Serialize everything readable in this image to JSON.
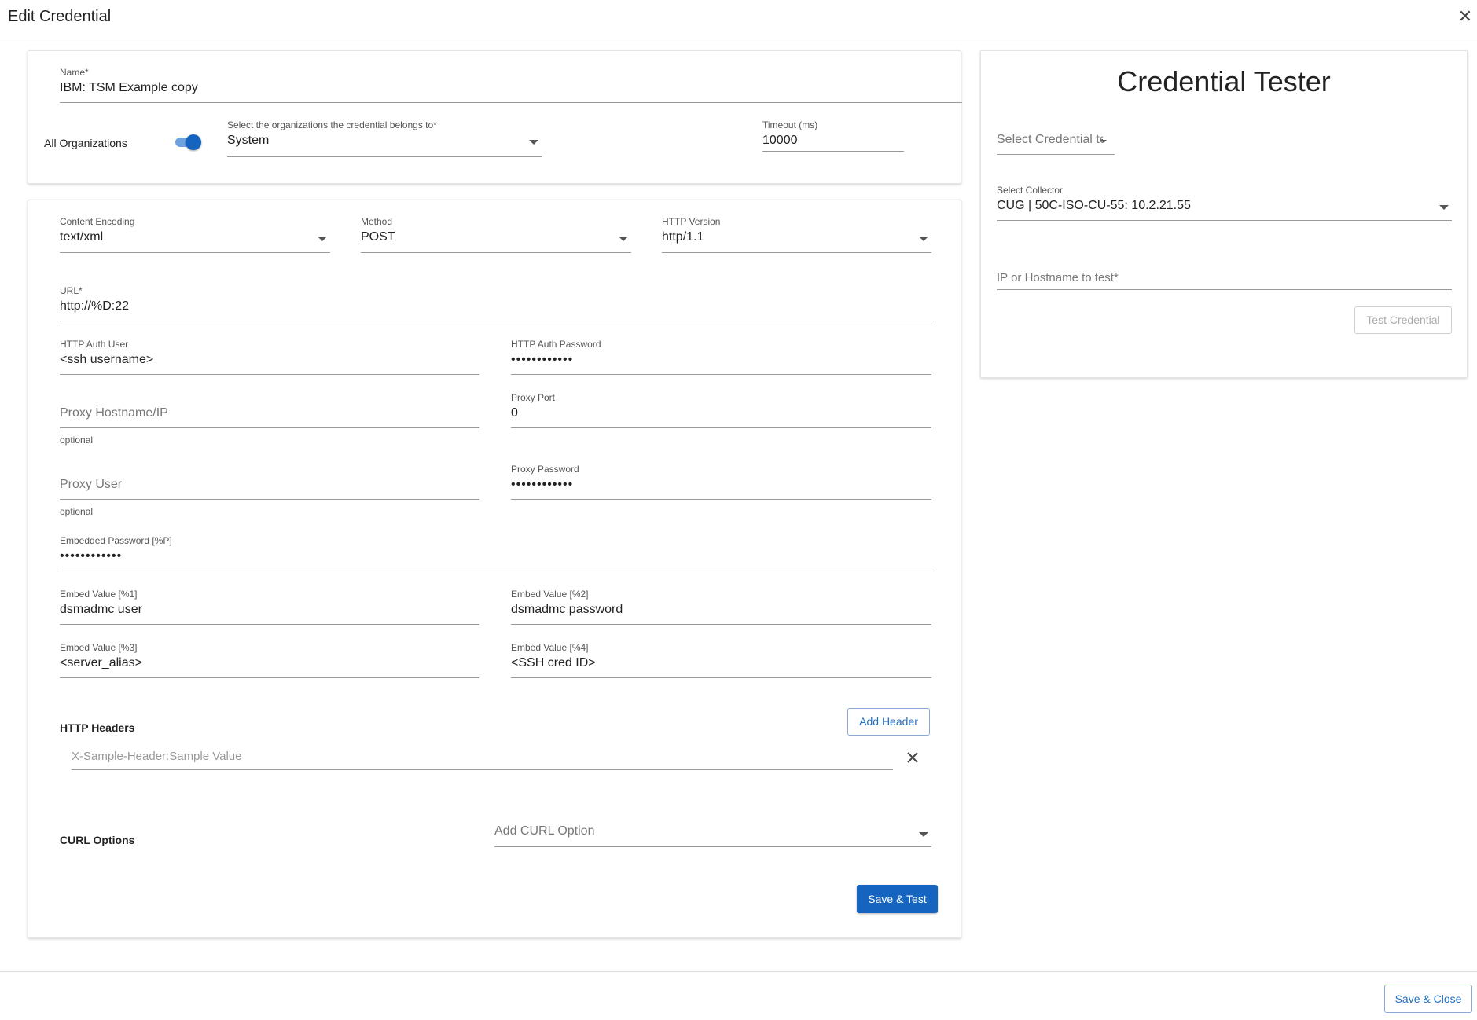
{
  "header": {
    "title": "Edit Credential",
    "close_glyph": "✕"
  },
  "top_card": {
    "name_label": "Name",
    "name_value": "IBM: TSM Example copy",
    "all_orgs_label": "All Organizations",
    "all_orgs_enabled": true,
    "orgs_label": "Select the organizations the credential belongs to",
    "orgs_value": "System",
    "timeout_label": "Timeout (ms)",
    "timeout_value": "10000",
    "required_mark": "*"
  },
  "main_card": {
    "content_encoding_label": "Content Encoding",
    "content_encoding_value": "text/xml",
    "method_label": "Method",
    "method_value": "POST",
    "http_version_label": "HTTP Version",
    "http_version_value": "http/1.1",
    "url_label": "URL",
    "url_value": "http://%D:22",
    "auth_user_label": "HTTP Auth User",
    "auth_user_value": "<ssh username>",
    "auth_password_label": "HTTP Auth Password",
    "auth_password_value": "••••••••••••",
    "proxy_host_placeholder": "Proxy Hostname/IP",
    "proxy_host_helper": "optional",
    "proxy_port_label": "Proxy Port",
    "proxy_port_value": "0",
    "proxy_user_placeholder": "Proxy User",
    "proxy_user_helper": "optional",
    "proxy_password_label": "Proxy Password",
    "proxy_password_value": "••••••••••••",
    "embedded_password_label": "Embedded Password [%P]",
    "embedded_password_value": "••••••••••••",
    "embed1_label": "Embed Value [%1]",
    "embed1_value": "dsmadmc user",
    "embed2_label": "Embed Value [%2]",
    "embed2_value": "dsmadmc password",
    "embed3_label": "Embed Value [%3]",
    "embed3_value": "<server_alias>",
    "embed4_label": "Embed Value [%4]",
    "embed4_value": "<SSH cred ID>",
    "http_headers_label": "HTTP Headers",
    "add_header_label": "Add Header",
    "header_placeholder": "X-Sample-Header:Sample Value",
    "curl_options_label": "CURL Options",
    "curl_placeholder": "Add CURL Option",
    "save_test_label": "Save & Test"
  },
  "tester": {
    "title": "Credential Tester",
    "select_credential_placeholder": "Select Credential te...",
    "collector_label": "Select Collector",
    "collector_value": "CUG | 50C-ISO-CU-55: 10.2.21.55",
    "ip_placeholder": "IP or Hostname to test",
    "test_button_label": "Test Credential"
  },
  "footer": {
    "save_close_label": "Save & Close"
  },
  "colors": {
    "primary": "#1565c0",
    "toggle_track": "#6ea2de"
  }
}
